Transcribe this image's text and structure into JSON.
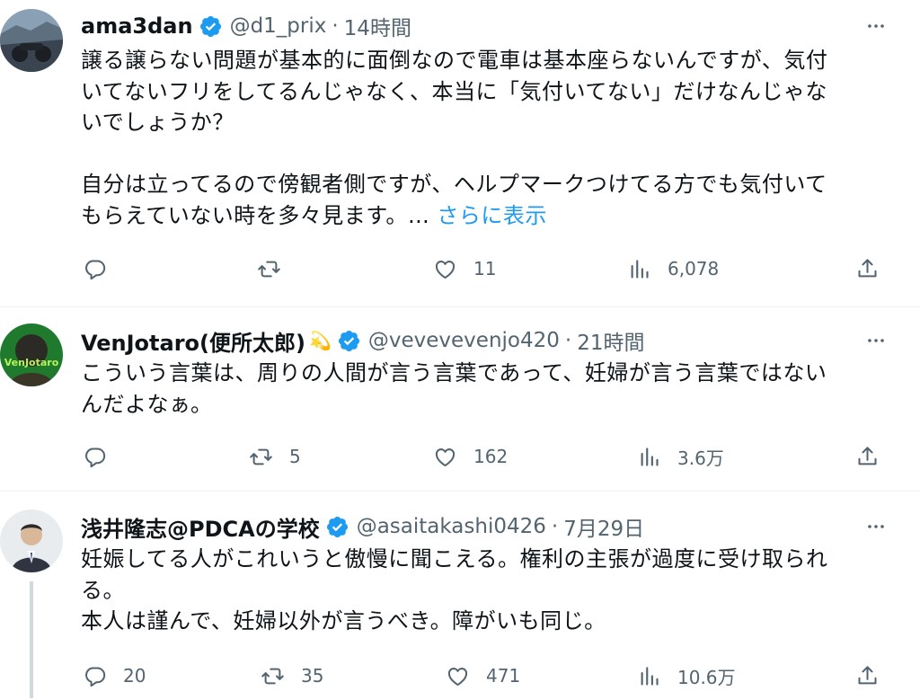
{
  "tweets": [
    {
      "name": "ama3dan",
      "handle": "@d1_prix",
      "time": "14時間",
      "lines": [
        "譲る譲らない問題が基本的に面倒なので電車は基本座らないんですが、気付",
        "いてないフリをしてるんじゃなく、本当に「気付いてない」だけなんじゃな",
        "いでしょうか？",
        "",
        "自分は立ってるので傍観者側ですが、ヘルプマークつけてる方でも気付いて",
        "もらえていない時を多々見ます。…"
      ],
      "show_more": "さらに表示",
      "replies": "",
      "retweets": "",
      "likes": "11",
      "views": "6,078"
    },
    {
      "name": "VenJotaro(便所太郎)",
      "handle": "@vevevevenjo420",
      "time": "21時間",
      "emoji": "💫",
      "avatar_text": "VenJotaro",
      "lines": [
        "こういう言葉は、周りの人間が言う言葉であって、妊婦が言う言葉ではない",
        "んだよなぁ。"
      ],
      "replies": "",
      "retweets": "5",
      "likes": "162",
      "views": "3.6万"
    },
    {
      "name": "浅井隆志@PDCAの学校",
      "handle": "@asaitakashi0426",
      "time": "7月29日",
      "lines": [
        "妊娠してる人がこれいうと傲慢に聞こえる。権利の主張が過度に受け取られ",
        "る。",
        "本人は謹んで、妊婦以外が言うべき。障がいも同じ。"
      ],
      "replies": "20",
      "retweets": "35",
      "likes": "471",
      "views": "10.6万"
    }
  ],
  "colors": {
    "text": "#0f1419",
    "secondary": "#536471",
    "link": "#1d9bf0",
    "verified": "#1d9bf0",
    "divider": "#eff3f4"
  },
  "icons": {
    "reply": "reply-icon",
    "retweet": "retweet-icon",
    "like": "heart-icon",
    "views": "views-icon",
    "share": "share-icon",
    "more": "more-icon",
    "verified": "verified-badge-icon"
  }
}
